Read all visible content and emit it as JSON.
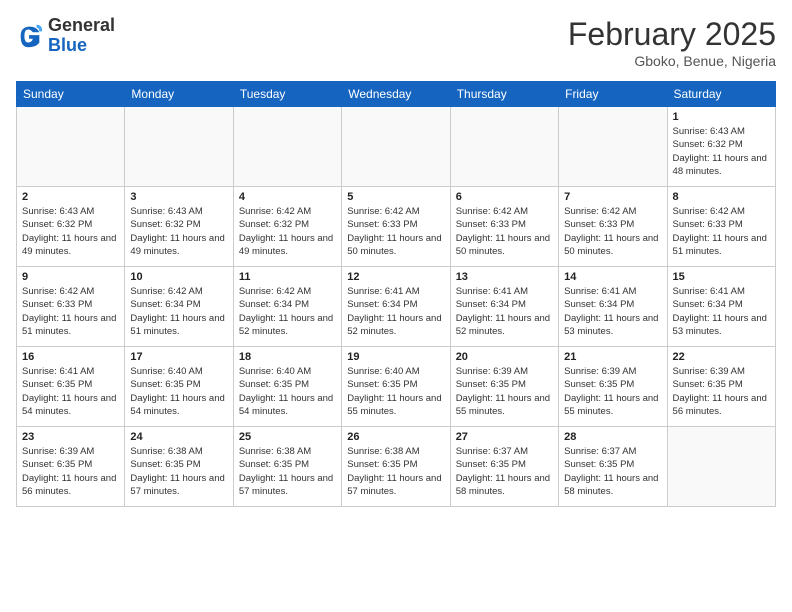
{
  "logo": {
    "line1": "General",
    "line2": "Blue"
  },
  "title": "February 2025",
  "location": "Gboko, Benue, Nigeria",
  "days_of_week": [
    "Sunday",
    "Monday",
    "Tuesday",
    "Wednesday",
    "Thursday",
    "Friday",
    "Saturday"
  ],
  "weeks": [
    [
      {
        "day": "",
        "info": ""
      },
      {
        "day": "",
        "info": ""
      },
      {
        "day": "",
        "info": ""
      },
      {
        "day": "",
        "info": ""
      },
      {
        "day": "",
        "info": ""
      },
      {
        "day": "",
        "info": ""
      },
      {
        "day": "1",
        "info": "Sunrise: 6:43 AM\nSunset: 6:32 PM\nDaylight: 11 hours and 48 minutes."
      }
    ],
    [
      {
        "day": "2",
        "info": "Sunrise: 6:43 AM\nSunset: 6:32 PM\nDaylight: 11 hours and 49 minutes."
      },
      {
        "day": "3",
        "info": "Sunrise: 6:43 AM\nSunset: 6:32 PM\nDaylight: 11 hours and 49 minutes."
      },
      {
        "day": "4",
        "info": "Sunrise: 6:42 AM\nSunset: 6:32 PM\nDaylight: 11 hours and 49 minutes."
      },
      {
        "day": "5",
        "info": "Sunrise: 6:42 AM\nSunset: 6:33 PM\nDaylight: 11 hours and 50 minutes."
      },
      {
        "day": "6",
        "info": "Sunrise: 6:42 AM\nSunset: 6:33 PM\nDaylight: 11 hours and 50 minutes."
      },
      {
        "day": "7",
        "info": "Sunrise: 6:42 AM\nSunset: 6:33 PM\nDaylight: 11 hours and 50 minutes."
      },
      {
        "day": "8",
        "info": "Sunrise: 6:42 AM\nSunset: 6:33 PM\nDaylight: 11 hours and 51 minutes."
      }
    ],
    [
      {
        "day": "9",
        "info": "Sunrise: 6:42 AM\nSunset: 6:33 PM\nDaylight: 11 hours and 51 minutes."
      },
      {
        "day": "10",
        "info": "Sunrise: 6:42 AM\nSunset: 6:34 PM\nDaylight: 11 hours and 51 minutes."
      },
      {
        "day": "11",
        "info": "Sunrise: 6:42 AM\nSunset: 6:34 PM\nDaylight: 11 hours and 52 minutes."
      },
      {
        "day": "12",
        "info": "Sunrise: 6:41 AM\nSunset: 6:34 PM\nDaylight: 11 hours and 52 minutes."
      },
      {
        "day": "13",
        "info": "Sunrise: 6:41 AM\nSunset: 6:34 PM\nDaylight: 11 hours and 52 minutes."
      },
      {
        "day": "14",
        "info": "Sunrise: 6:41 AM\nSunset: 6:34 PM\nDaylight: 11 hours and 53 minutes."
      },
      {
        "day": "15",
        "info": "Sunrise: 6:41 AM\nSunset: 6:34 PM\nDaylight: 11 hours and 53 minutes."
      }
    ],
    [
      {
        "day": "16",
        "info": "Sunrise: 6:41 AM\nSunset: 6:35 PM\nDaylight: 11 hours and 54 minutes."
      },
      {
        "day": "17",
        "info": "Sunrise: 6:40 AM\nSunset: 6:35 PM\nDaylight: 11 hours and 54 minutes."
      },
      {
        "day": "18",
        "info": "Sunrise: 6:40 AM\nSunset: 6:35 PM\nDaylight: 11 hours and 54 minutes."
      },
      {
        "day": "19",
        "info": "Sunrise: 6:40 AM\nSunset: 6:35 PM\nDaylight: 11 hours and 55 minutes."
      },
      {
        "day": "20",
        "info": "Sunrise: 6:39 AM\nSunset: 6:35 PM\nDaylight: 11 hours and 55 minutes."
      },
      {
        "day": "21",
        "info": "Sunrise: 6:39 AM\nSunset: 6:35 PM\nDaylight: 11 hours and 55 minutes."
      },
      {
        "day": "22",
        "info": "Sunrise: 6:39 AM\nSunset: 6:35 PM\nDaylight: 11 hours and 56 minutes."
      }
    ],
    [
      {
        "day": "23",
        "info": "Sunrise: 6:39 AM\nSunset: 6:35 PM\nDaylight: 11 hours and 56 minutes."
      },
      {
        "day": "24",
        "info": "Sunrise: 6:38 AM\nSunset: 6:35 PM\nDaylight: 11 hours and 57 minutes."
      },
      {
        "day": "25",
        "info": "Sunrise: 6:38 AM\nSunset: 6:35 PM\nDaylight: 11 hours and 57 minutes."
      },
      {
        "day": "26",
        "info": "Sunrise: 6:38 AM\nSunset: 6:35 PM\nDaylight: 11 hours and 57 minutes."
      },
      {
        "day": "27",
        "info": "Sunrise: 6:37 AM\nSunset: 6:35 PM\nDaylight: 11 hours and 58 minutes."
      },
      {
        "day": "28",
        "info": "Sunrise: 6:37 AM\nSunset: 6:35 PM\nDaylight: 11 hours and 58 minutes."
      },
      {
        "day": "",
        "info": ""
      }
    ]
  ]
}
